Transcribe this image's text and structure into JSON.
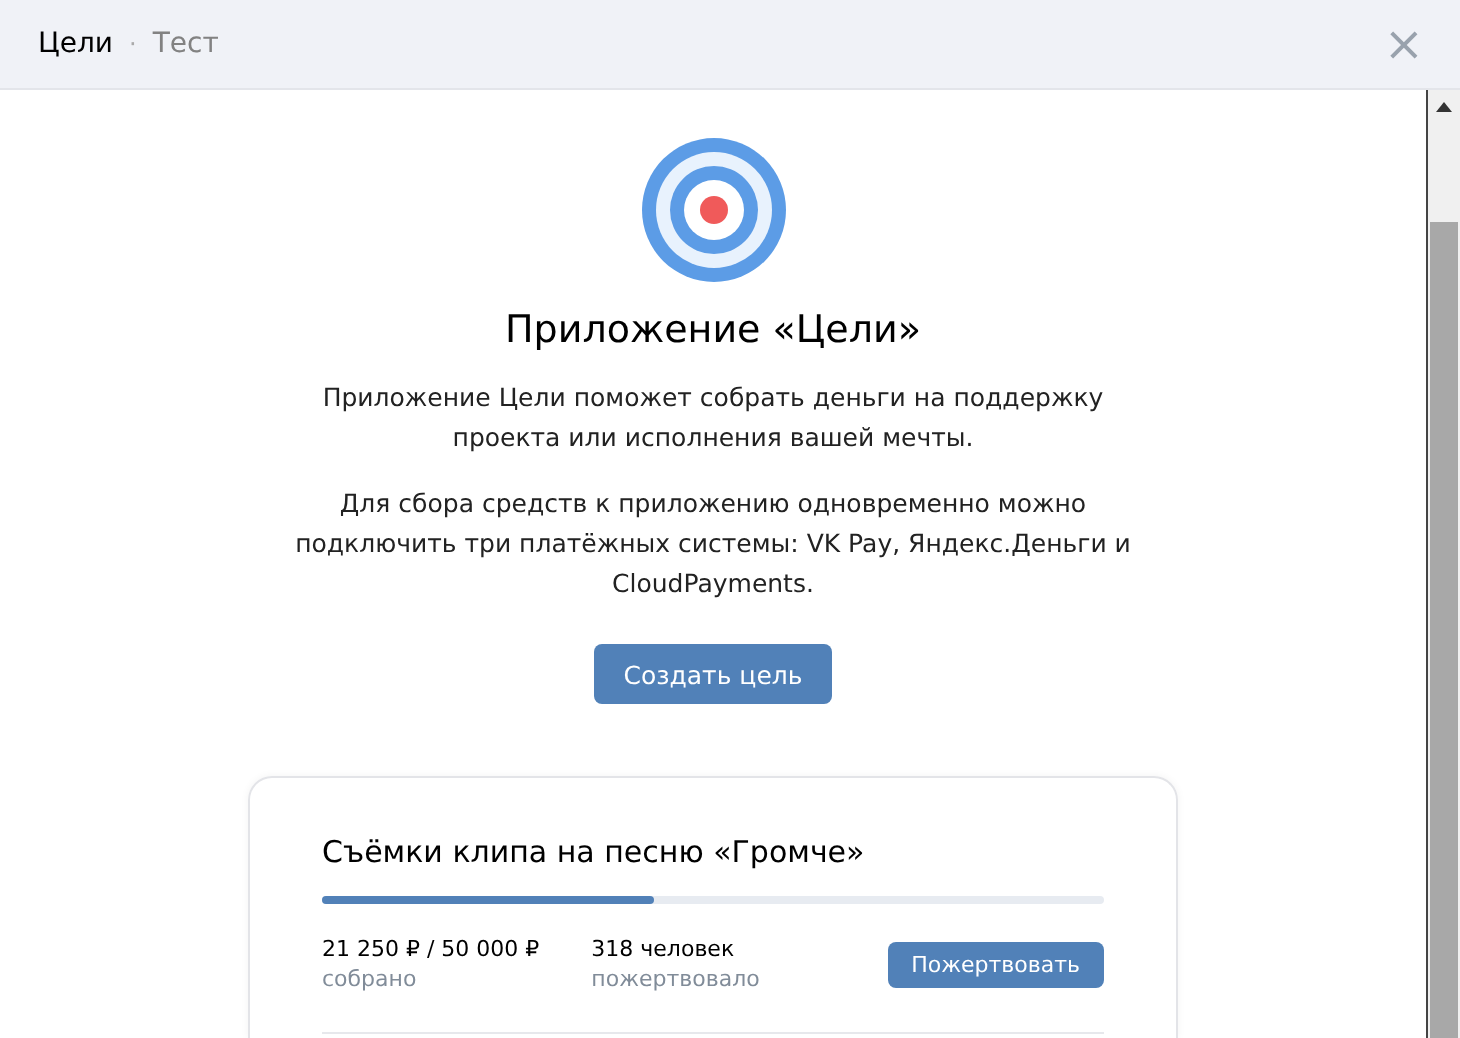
{
  "header": {
    "breadcrumbs": [
      {
        "label": "Цели",
        "selected": true
      },
      {
        "label": "Тест",
        "selected": false
      }
    ],
    "separator": "·",
    "close": "×"
  },
  "intro": {
    "title": "Приложение «Цели»",
    "paragraphs": [
      "Приложение Цели поможет собрать деньги на поддержку проекта или исполнения вашей мечты.",
      "Для сбора средств к приложению одновременно можно подключить три платёжных системы: VK Pay, Яндекс.Деньги и CloudPayments."
    ],
    "button": "Создать цель"
  },
  "goal": {
    "title": "Съёмки клипа на песню «Громче»",
    "level": 0.425,
    "stats": [
      {
        "value": "21 250 ₽ / 50 000 ₽",
        "label": "собрано"
      },
      {
        "value": "318 человек",
        "label": "пожертвовало"
      }
    ],
    "button": "Пожертвовать"
  }
}
